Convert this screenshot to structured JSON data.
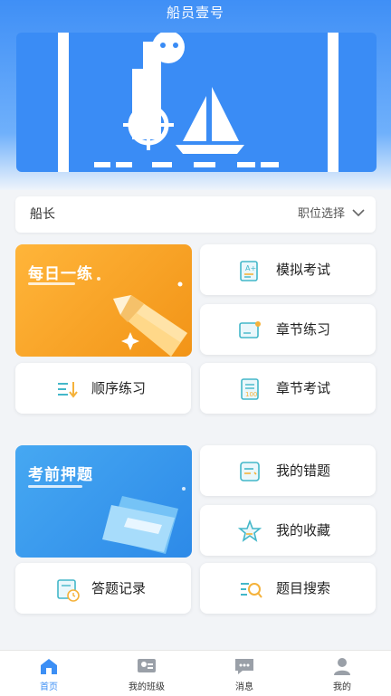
{
  "app": {
    "title": "船员壹号"
  },
  "banner": {
    "brand_text": "船员壹号"
  },
  "selector": {
    "rank": "船长",
    "position_label": "职位选择"
  },
  "sections": {
    "daily": {
      "title": "每日一练"
    },
    "prediction": {
      "title": "考前押题"
    }
  },
  "buttons": {
    "mock_exam": "模拟考试",
    "chapter_practice": "章节练习",
    "sequential_practice": "顺序练习",
    "chapter_exam": "章节考试",
    "my_mistakes": "我的错题",
    "my_favorites": "我的收藏",
    "answer_record": "答题记录",
    "question_search": "题目搜索"
  },
  "tabs": [
    {
      "label": "首页",
      "icon": "home-icon",
      "active": true
    },
    {
      "label": "我的班级",
      "icon": "class-icon",
      "active": false
    },
    {
      "label": "消息",
      "icon": "message-icon",
      "active": false
    },
    {
      "label": "我的",
      "icon": "user-icon",
      "active": false
    }
  ],
  "colors": {
    "primary": "#3c8ff5",
    "daily_card": "#f7a528",
    "prediction_card": "#3a9ef0"
  }
}
